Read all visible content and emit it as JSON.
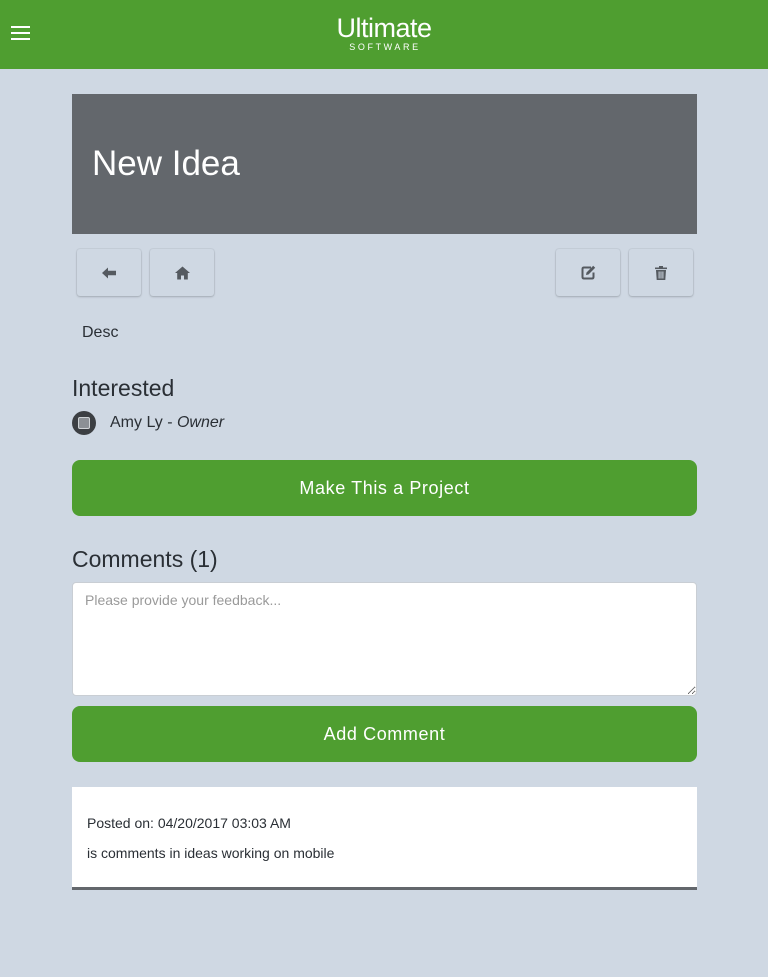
{
  "header": {
    "logo_main": "Ultimate",
    "logo_sub": "SOFTWARE",
    "brand_color": "#4f9e30",
    "menu_icon": "hamburger-menu-icon"
  },
  "idea": {
    "title": "New Idea",
    "description": "Desc"
  },
  "toolbar": {
    "back_icon": "arrow-left-icon",
    "home_icon": "home-icon",
    "edit_icon": "edit-icon",
    "delete_icon": "trash-icon"
  },
  "interested": {
    "heading": "Interested",
    "people": [
      {
        "name": "Amy Ly",
        "separator": " - ",
        "role": "Owner"
      }
    ]
  },
  "actions": {
    "make_project_label": "Make This a Project",
    "add_comment_label": "Add Comment"
  },
  "comments": {
    "heading": "Comments (1)",
    "input_placeholder": "Please provide your feedback...",
    "input_value": "",
    "items": [
      {
        "posted_label": "Posted on:",
        "posted_on": "04/20/2017 03:03 AM",
        "text": "is comments in ideas working on mobile"
      }
    ]
  }
}
